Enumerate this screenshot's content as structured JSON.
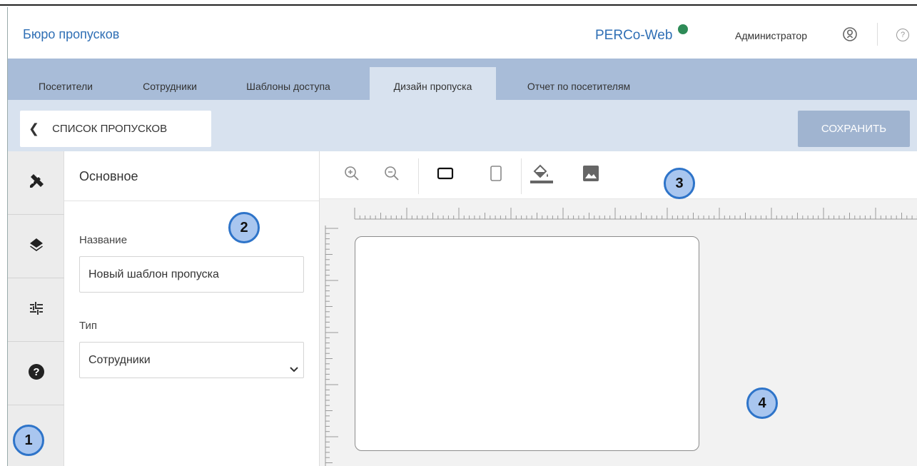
{
  "header": {
    "app_title": "Бюро пропусков",
    "brand": "PERCo-Web",
    "user_name": "Администратор",
    "status_color": "#2e8b57",
    "help_symbol": "?"
  },
  "tabs": [
    {
      "label": "Посетители",
      "active": false
    },
    {
      "label": "Сотрудники",
      "active": false
    },
    {
      "label": "Шаблоны доступа",
      "active": false
    },
    {
      "label": "Дизайн пропуска",
      "active": true
    },
    {
      "label": "Отчет по посетителям",
      "active": false
    }
  ],
  "actionbar": {
    "back_label": "СПИСОК ПРОПУСКОВ",
    "save_label": "СОХРАНИТЬ"
  },
  "rail": {
    "items": [
      {
        "icon": "design-tools-icon",
        "active": true
      },
      {
        "icon": "layers-icon",
        "active": false
      },
      {
        "icon": "sliders-icon",
        "active": false
      },
      {
        "icon": "help-icon",
        "active": false
      }
    ]
  },
  "panel": {
    "heading": "Основное",
    "name_label": "Название",
    "name_value": "Новый шаблон пропуска",
    "type_label": "Тип",
    "type_value": "Сотрудники"
  },
  "toolbar": {
    "tools": [
      "zoom-in-icon",
      "zoom-out-icon",
      "landscape-icon",
      "portrait-icon",
      "fill-color-icon",
      "image-icon"
    ]
  },
  "markers": [
    "1",
    "2",
    "3",
    "4"
  ],
  "colors": {
    "accent": "#2f6fb5",
    "tab_bar": "#a8bcd8",
    "action_bar": "#d8e2ef",
    "save_button": "#a0b4d0",
    "marker_fill": "#a9c6ef",
    "marker_border": "#2e74c9"
  }
}
